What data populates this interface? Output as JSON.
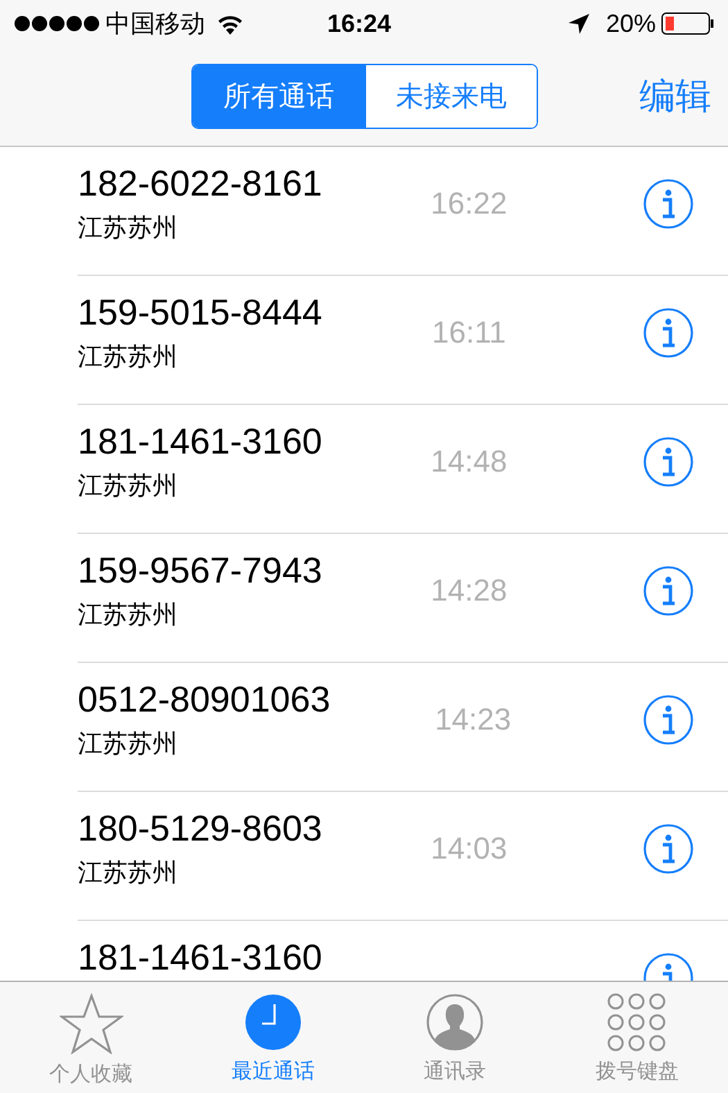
{
  "status_bar": {
    "carrier": "中国移动",
    "time": "16:24",
    "battery": "20%"
  },
  "segments": [
    {
      "label": "所有通话",
      "selected": true
    },
    {
      "label": "未接来电",
      "selected": false
    }
  ],
  "edit_button": "编辑",
  "calls": [
    {
      "number": "182-6022-8161",
      "location": "江苏苏州",
      "time": "16:22"
    },
    {
      "number": "159-5015-8444",
      "location": "江苏苏州",
      "time": "16:11"
    },
    {
      "number": "181-1461-3160",
      "location": "江苏苏州",
      "time": "14:48"
    },
    {
      "number": "159-9567-7943",
      "location": "江苏苏州",
      "time": "14:28"
    },
    {
      "number": "0512-80901063",
      "location": "江苏苏州",
      "time": "14:23"
    },
    {
      "number": "180-5129-8603",
      "location": "江苏苏州",
      "time": "14:03"
    },
    {
      "number": "181-1461-3160"
    }
  ],
  "tab_bar": [
    {
      "label": "个人收藏",
      "kind": "star",
      "selected": false
    },
    {
      "label": "最近通话",
      "kind": "clock",
      "selected": true
    },
    {
      "label": "通讯录",
      "kind": "contact",
      "selected": false
    },
    {
      "label": "拨号键盘",
      "kind": "keypad",
      "selected": false
    }
  ]
}
